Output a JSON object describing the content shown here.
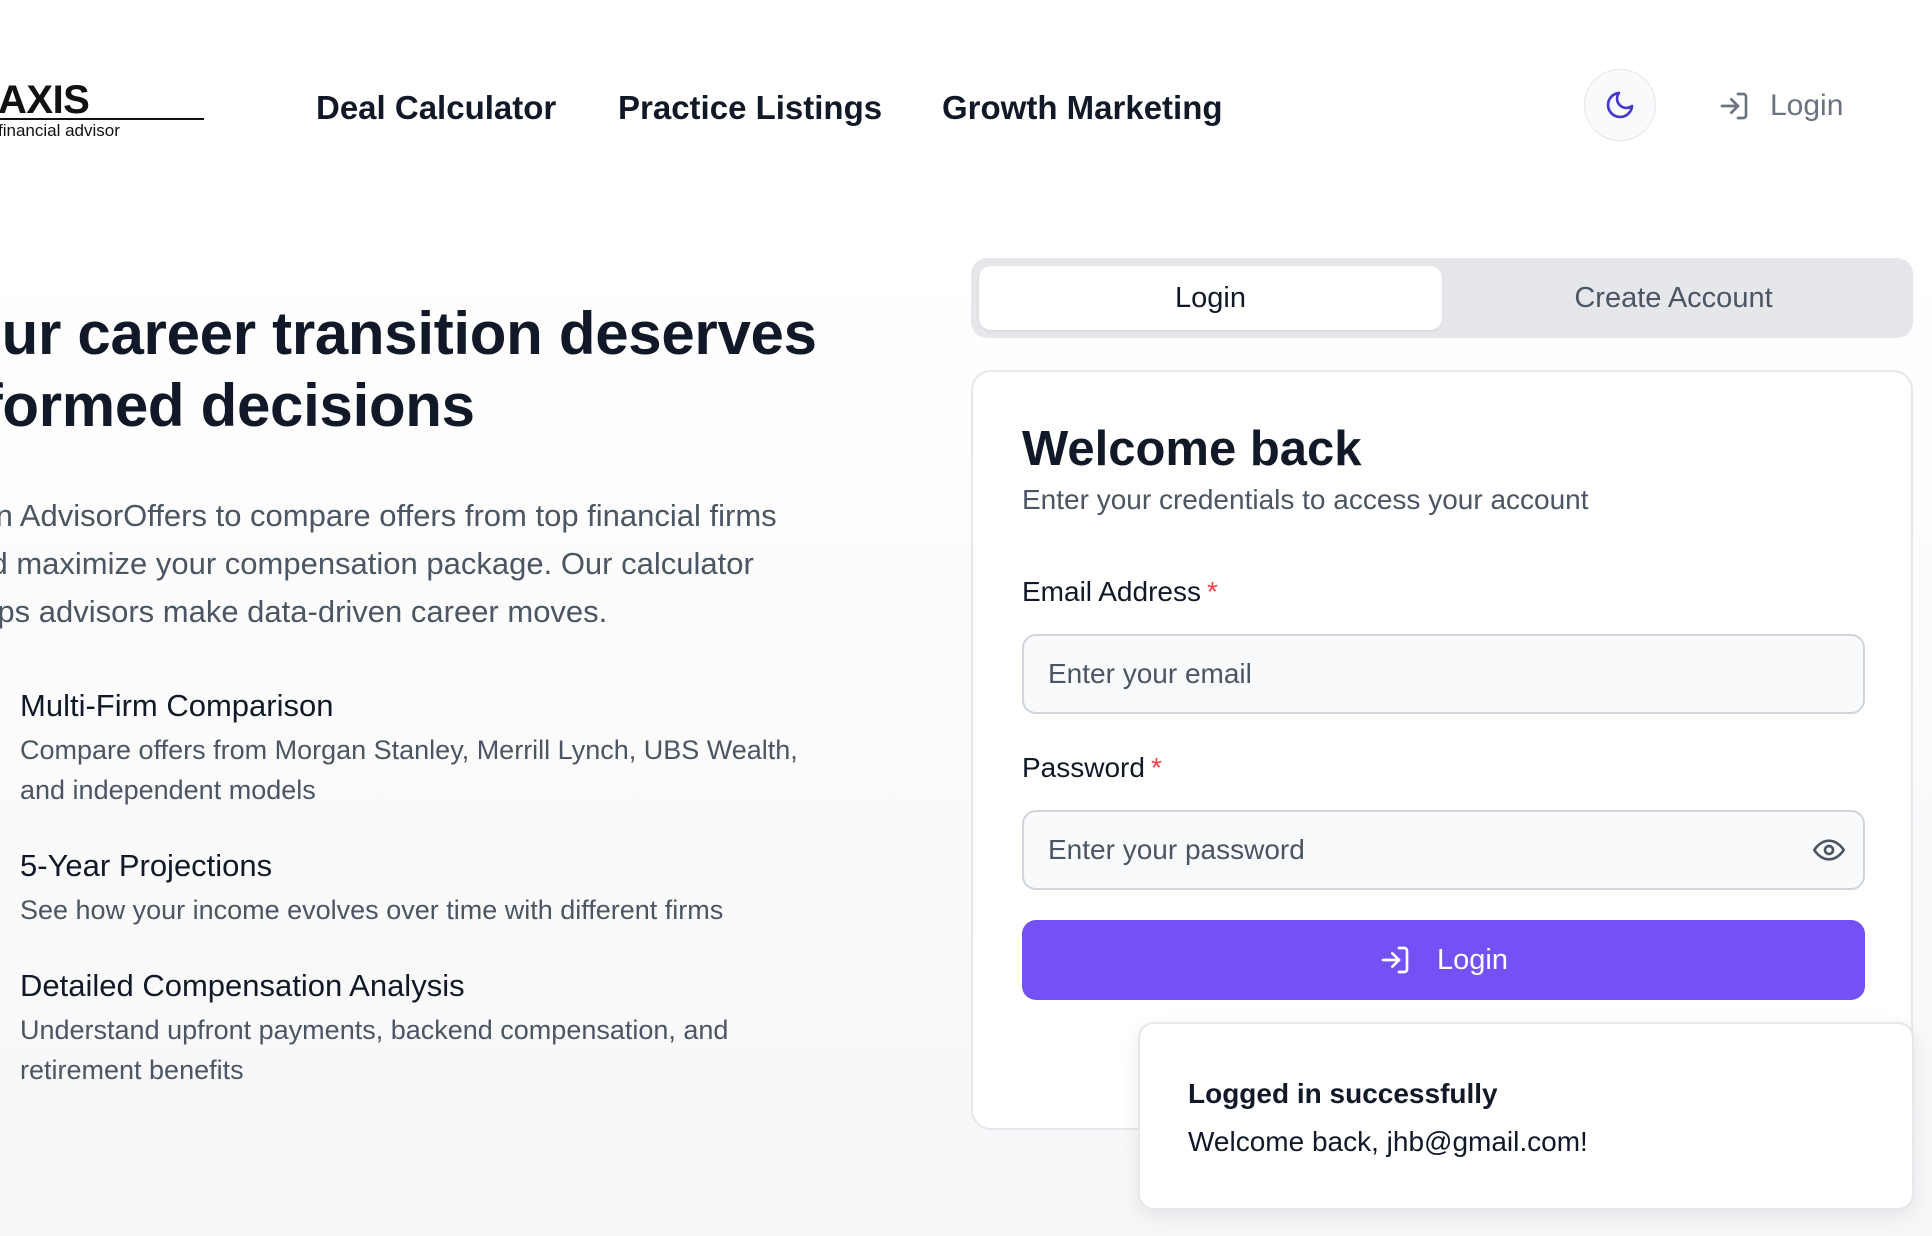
{
  "logo": {
    "word": "AXIS",
    "tagline": "financial advisor"
  },
  "nav": {
    "items": [
      {
        "label": "Deal Calculator"
      },
      {
        "label": "Practice Listings"
      },
      {
        "label": "Growth Marketing"
      }
    ],
    "theme_icon": "moon-icon",
    "login_label": "Login",
    "login_icon": "log-in-icon"
  },
  "hero": {
    "title_line1": "Your career transition deserves",
    "title_line2": "informed decisions",
    "desc_line1": "Join AdvisorOffers to compare offers from top financial firms",
    "desc_line2": "and maximize your compensation package. Our calculator",
    "desc_line3": "helps advisors make data-driven career moves.",
    "features": [
      {
        "title": "Multi-Firm Comparison",
        "desc_line1": "Compare offers from Morgan Stanley, Merrill Lynch, UBS Wealth,",
        "desc_line2": "and independent models"
      },
      {
        "title": "5-Year Projections",
        "desc_line1": "See how your income evolves over time with different firms",
        "desc_line2": ""
      },
      {
        "title": "Detailed Compensation Analysis",
        "desc_line1": "Understand upfront payments, backend compensation, and",
        "desc_line2": "retirement benefits"
      }
    ]
  },
  "auth": {
    "tabs": [
      {
        "label": "Login",
        "active": true
      },
      {
        "label": "Create Account",
        "active": false
      }
    ],
    "card": {
      "title": "Welcome back",
      "subtitle": "Enter your credentials to access your account",
      "email_label": "Email Address",
      "email_placeholder": "Enter your email",
      "email_value": "",
      "password_label": "Password",
      "password_placeholder": "Enter your password",
      "password_value": "",
      "required_mark": "*",
      "submit_label": "Login",
      "submit_icon": "log-in-icon",
      "eye_icon": "eye-icon"
    }
  },
  "toast": {
    "title": "Logged in successfully",
    "message": "Welcome back, jhb@gmail.com!"
  },
  "colors": {
    "accent": "#7351f5",
    "theme_icon": "#4338ca",
    "required": "#ef4444",
    "text_primary": "#111827",
    "text_secondary": "#4b5563"
  }
}
